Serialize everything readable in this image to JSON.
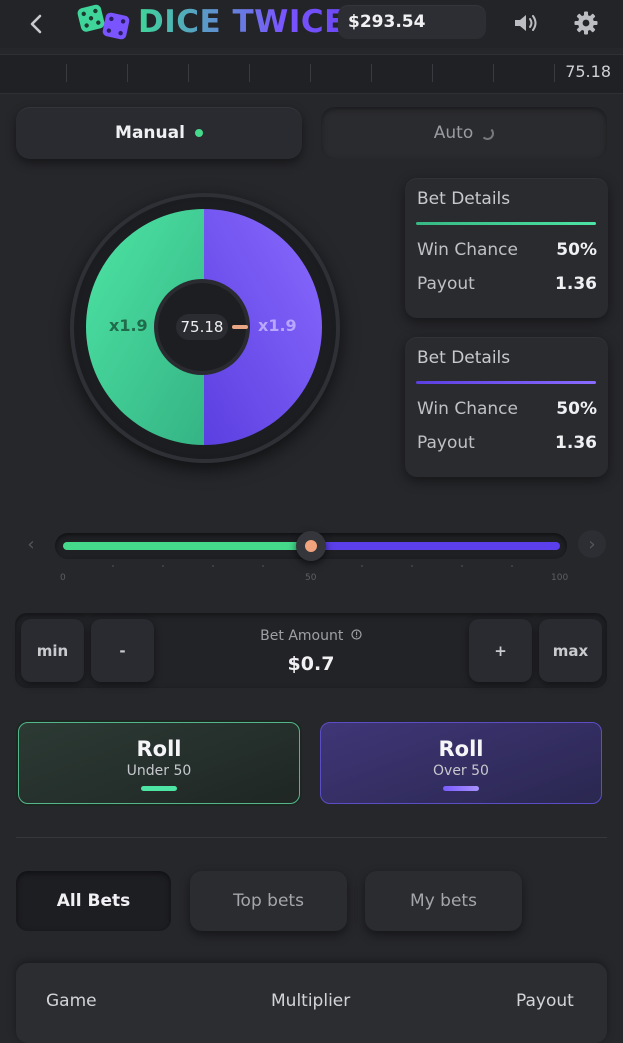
{
  "header": {
    "logo_text": "DICE TWICE",
    "balance": "$293.54"
  },
  "history": {
    "last_value": "75.18"
  },
  "mode_tabs": {
    "manual": "Manual",
    "auto": "Auto"
  },
  "wheel": {
    "left_multiplier": "x1.9",
    "right_multiplier": "x1.9",
    "center_value": "75.18",
    "colors": {
      "green": "#45d98c",
      "purple": "#6b4ff5"
    }
  },
  "bet_details": [
    {
      "title": "Bet Details",
      "win_chance_label": "Win Chance",
      "win_chance": "50%",
      "payout_label": "Payout",
      "payout": "1.36",
      "accent": "#45d98c"
    },
    {
      "title": "Bet Details",
      "win_chance_label": "Win Chance",
      "win_chance": "50%",
      "payout_label": "Payout",
      "payout": "1.36",
      "accent": "#7a5cff"
    }
  ],
  "slider": {
    "value": 50,
    "min_label": "0",
    "mid_label": "50",
    "max_label": "100"
  },
  "bet_amount": {
    "min_label": "min",
    "minus_label": "-",
    "label": "Bet Amount",
    "value": "$0.7",
    "plus_label": "+",
    "max_label": "max"
  },
  "roll": {
    "under": {
      "title": "Roll",
      "subtitle": "Under 50"
    },
    "over": {
      "title": "Roll",
      "subtitle": "Over 50"
    }
  },
  "bets_tabs": {
    "all": "All Bets",
    "top": "Top bets",
    "my": "My bets"
  },
  "table": {
    "columns": [
      "Game",
      "Multiplier",
      "Payout"
    ]
  }
}
